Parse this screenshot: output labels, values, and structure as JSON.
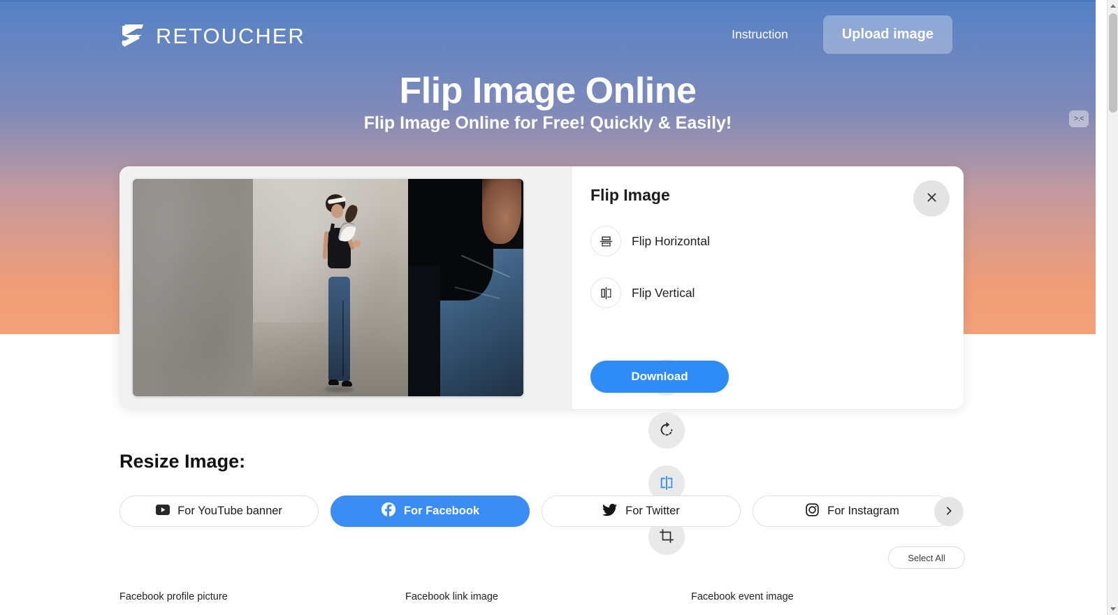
{
  "header": {
    "logo_text": "RETOUCHER",
    "logo_icon": "retoucher-logo-icon",
    "nav_link": "Instruction",
    "upload_label": "Upload image"
  },
  "hero": {
    "title": "Flip Image Online",
    "subtitle": "Flip Image Online for Free! Quickly & Easily!",
    "gradient_top": "#5581c6",
    "gradient_bottom": "#f4a179"
  },
  "editor": {
    "toolbar": [
      {
        "name": "resize-tool",
        "icon": "resize-icon",
        "active": false
      },
      {
        "name": "rotate-tool",
        "icon": "rotate-clockwise-icon",
        "active": false
      },
      {
        "name": "flip-tool",
        "icon": "flip-icon",
        "active": true
      },
      {
        "name": "crop-tool",
        "icon": "crop-icon",
        "active": false
      }
    ],
    "panel": {
      "title": "Flip Image",
      "close_icon": "close-icon",
      "options": [
        {
          "label": "Flip Horizontal",
          "icon": "flip-horizontal-icon"
        },
        {
          "label": "Flip Vertical",
          "icon": "flip-vertical-icon"
        }
      ],
      "download_label": "Download",
      "accent_color": "#2f8cf6"
    }
  },
  "resize": {
    "heading": "Resize Image:",
    "chips": [
      {
        "label": "For YouTube banner",
        "icon": "youtube-icon",
        "active": false
      },
      {
        "label": "For Facebook",
        "icon": "facebook-icon",
        "active": true
      },
      {
        "label": "For Twitter",
        "icon": "twitter-icon",
        "active": false
      },
      {
        "label": "For Instagram",
        "icon": "instagram-icon",
        "active": false
      }
    ],
    "next_icon": "chevron-right-icon",
    "select_all_label": "Select All",
    "card_labels": [
      "Facebook profile picture",
      "Facebook link image",
      "Facebook event image"
    ]
  },
  "float_widget": {
    "label": ">.<"
  }
}
